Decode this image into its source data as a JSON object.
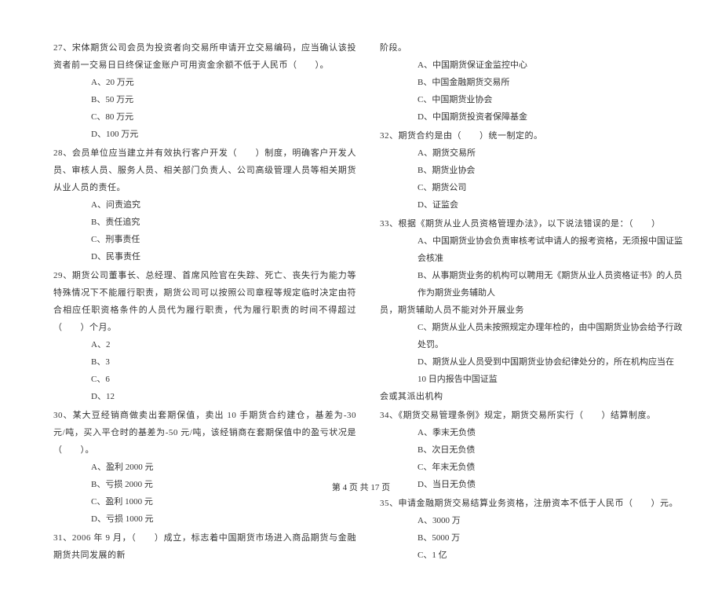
{
  "left_column": {
    "q27": {
      "text": "27、宋体期货公司会员为投资者向交易所申请开立交易编码，应当确认该投资者前一交易日日终保证金账户可用资金余额不低于人民币（　　）。",
      "options": [
        "A、20 万元",
        "B、50 万元",
        "C、80 万元",
        "D、100 万元"
      ]
    },
    "q28": {
      "text": "28、会员单位应当建立并有效执行客户开发（　　）制度，明确客户开发人员、审核人员、服务人员、相关部门负责人、公司高级管理人员等相关期货从业人员的责任。",
      "options": [
        "A、问责追究",
        "B、责任追究",
        "C、刑事责任",
        "D、民事责任"
      ]
    },
    "q29": {
      "text": "29、期货公司董事长、总经理、首席风险官在失踪、死亡、丧失行为能力等特殊情况下不能履行职责，期货公司可以按照公司章程等规定临时决定由符合相应任职资格条件的人员代为履行职责，代为履行职责的时间不得超过（　　）个月。",
      "options": [
        "A、2",
        "B、3",
        "C、6",
        "D、12"
      ]
    },
    "q30": {
      "text": "30、某大豆经销商做卖出套期保值，卖出 10 手期货合约建仓，基差为-30 元/吨，买入平仓时的基差为-50 元/吨，该经销商在套期保值中的盈亏状况是（　　）。",
      "options": [
        "A、盈利 2000 元",
        "B、亏损 2000 元",
        "C、盈利 1000 元",
        "D、亏损 1000 元"
      ]
    },
    "q31": {
      "text": "31、2006 年 9 月，（　　）成立，标志着中国期货市场进入商品期货与金融期货共同发展的新"
    }
  },
  "right_column": {
    "q31_cont": {
      "text": "阶段。",
      "options": [
        "A、中国期货保证金监控中心",
        "B、中国金融期货交易所",
        "C、中国期货业协会",
        "D、中国期货投资者保障基金"
      ]
    },
    "q32": {
      "text": "32、期货合约是由（　　）统一制定的。",
      "options": [
        "A、期货交易所",
        "B、期货业协会",
        "C、期货公司",
        "D、证监会"
      ]
    },
    "q33": {
      "text": "33、根据《期货从业人员资格管理办法》，以下说法错误的是：（　　）",
      "options": [
        "A、中国期货业协会负责审核考试申请人的报考资格，无须报中国证监会核准",
        "B、从事期货业务的机构可以聘用无《期货从业人员资格证书》的人员作为期货业务辅助人",
        "C、期货从业人员未按照规定办理年检的，由中国期货业协会给予行政处罚。",
        "D、期货从业人员受到中国期货业协会纪律处分的，所在机构应当在 10 日内报告中国证监"
      ],
      "extra_b": "员，期货辅助人员不能对外开展业务",
      "extra_d": "会或其派出机构"
    },
    "q34": {
      "text": "34、《期货交易管理条例》规定，期货交易所实行（　　）结算制度。",
      "options": [
        "A、季末无负债",
        "B、次日无负债",
        "C、年末无负债",
        "D、当日无负债"
      ]
    },
    "q35": {
      "text": "35、申请金融期货交易结算业务资格，注册资本不低于人民币（　　）元。",
      "options": [
        "A、3000 万",
        "B、5000 万",
        "C、1 亿"
      ]
    }
  },
  "footer": "第 4 页 共 17 页"
}
